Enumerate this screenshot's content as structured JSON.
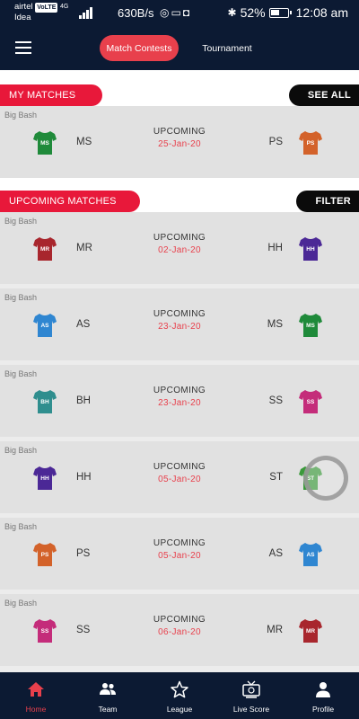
{
  "status_bar": {
    "carrier1": "airtel",
    "lte_badge": "VoLTE",
    "network": "4G",
    "carrier2": "Idea",
    "speed": "630B/s",
    "battery": "52%",
    "time": "12:08 am"
  },
  "header": {
    "tabs": [
      {
        "label": "Match Contests",
        "active": true
      },
      {
        "label": "Tournament",
        "active": false
      }
    ]
  },
  "my_matches": {
    "title": "MY MATCHES",
    "action": "SEE ALL",
    "matches": [
      {
        "league": "Big Bash",
        "team1": "MS",
        "team1_color": "#1f8a3a",
        "status": "UPCOMING",
        "date": "25-Jan-20",
        "team2": "PS",
        "team2_color": "#d3622a"
      }
    ]
  },
  "upcoming_matches": {
    "title": "UPCOMING MATCHES",
    "action": "FILTER",
    "matches": [
      {
        "league": "Big Bash",
        "team1": "MR",
        "team1_color": "#a8262d",
        "status": "UPCOMING",
        "date": "02-Jan-20",
        "team2": "HH",
        "team2_color": "#4b2896"
      },
      {
        "league": "Big Bash",
        "team1": "AS",
        "team1_color": "#2f86d1",
        "status": "UPCOMING",
        "date": "23-Jan-20",
        "team2": "MS",
        "team2_color": "#1f8a3a"
      },
      {
        "league": "Big Bash",
        "team1": "BH",
        "team1_color": "#2f8e8e",
        "status": "UPCOMING",
        "date": "23-Jan-20",
        "team2": "SS",
        "team2_color": "#c42c7a"
      },
      {
        "league": "Big Bash",
        "team1": "HH",
        "team1_color": "#4b2896",
        "status": "UPCOMING",
        "date": "05-Jan-20",
        "team2": "ST",
        "team2_color": "#3a9a3a"
      },
      {
        "league": "Big Bash",
        "team1": "PS",
        "team1_color": "#d3622a",
        "status": "UPCOMING",
        "date": "05-Jan-20",
        "team2": "AS",
        "team2_color": "#2f86d1"
      },
      {
        "league": "Big Bash",
        "team1": "SS",
        "team1_color": "#c42c7a",
        "status": "UPCOMING",
        "date": "06-Jan-20",
        "team2": "MR",
        "team2_color": "#a8262d"
      }
    ]
  },
  "bottom_nav": [
    {
      "label": "Home",
      "icon": "home-icon",
      "active": true
    },
    {
      "label": "Team",
      "icon": "team-icon",
      "active": false
    },
    {
      "label": "League",
      "icon": "star-icon",
      "active": false
    },
    {
      "label": "Live Score",
      "icon": "tv-icon",
      "active": false
    },
    {
      "label": "Profile",
      "icon": "profile-icon",
      "active": false
    }
  ],
  "colors": {
    "accent": "#e8404c",
    "navy": "#0c1a33",
    "section_red": "#e8183a"
  }
}
